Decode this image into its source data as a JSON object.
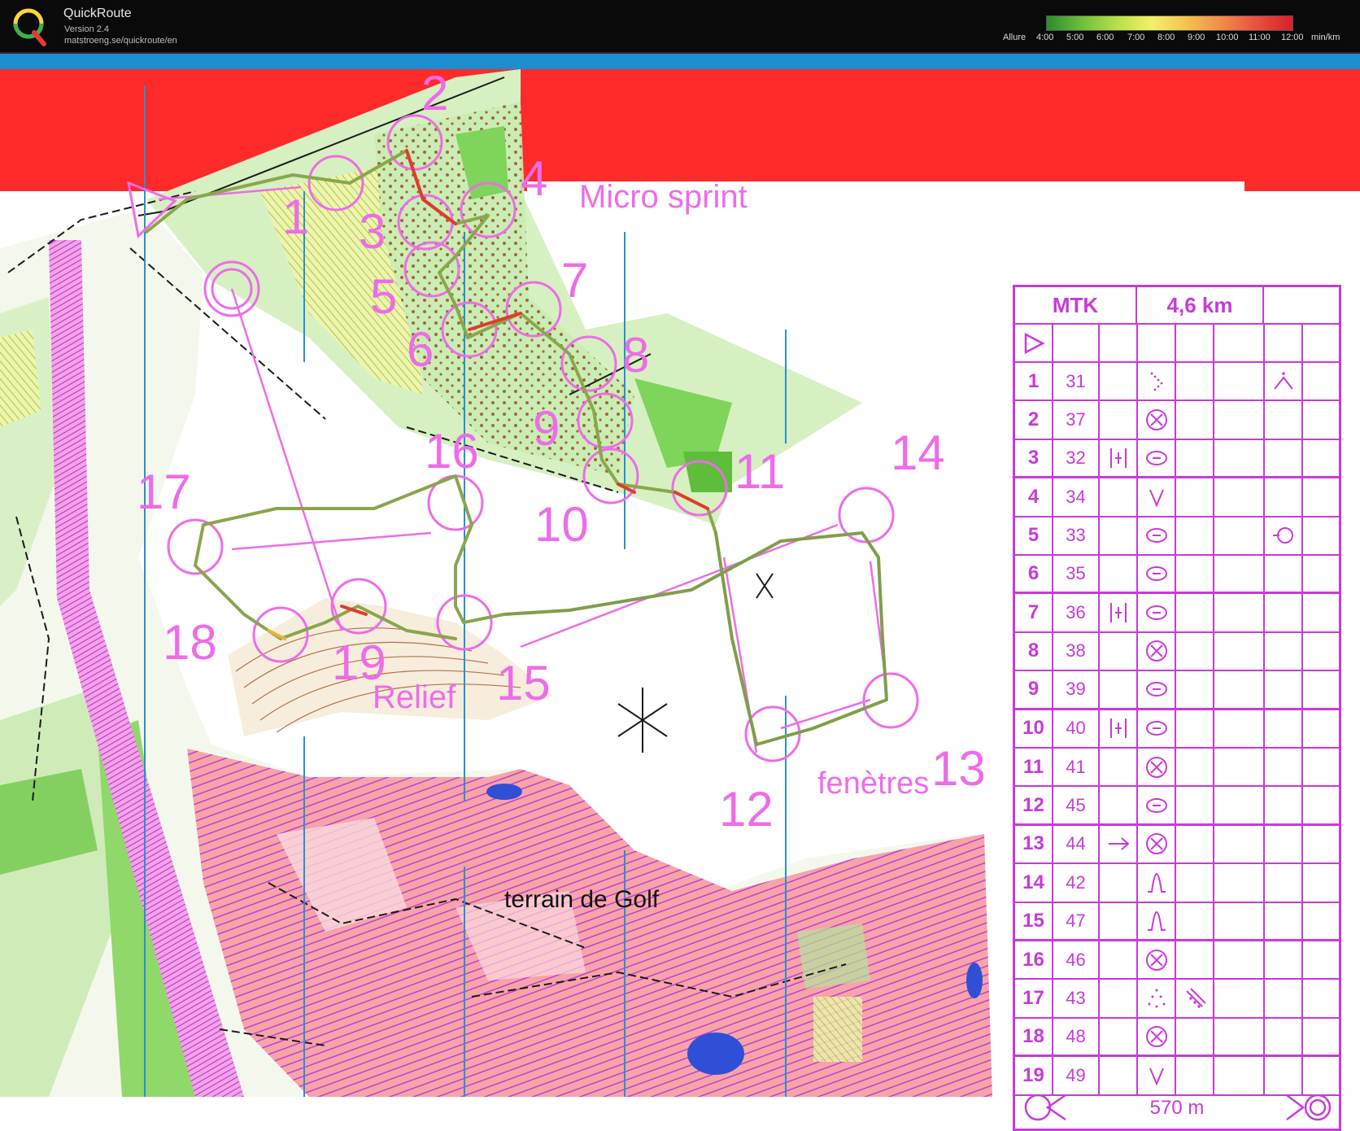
{
  "header": {
    "app_name": "QuickRoute",
    "version": "Version 2.4",
    "url": "matstroeng.se/quickroute/en",
    "pace_caption": "Allure",
    "pace_ticks": [
      "4:00",
      "5:00",
      "6:00",
      "7:00",
      "8:00",
      "9:00",
      "10:00",
      "11:00",
      "12:00"
    ],
    "pace_unit": "min/km"
  },
  "map": {
    "labels": {
      "micro_sprint": "Micro sprint",
      "relief": "Relief",
      "fenetres": "fenètres",
      "golf": "terrain de Golf"
    },
    "controls": [
      "1",
      "2",
      "3",
      "4",
      "5",
      "6",
      "7",
      "8",
      "9",
      "10",
      "11",
      "12",
      "13",
      "14",
      "15",
      "16",
      "17",
      "18",
      "19"
    ]
  },
  "sheet": {
    "club": "MTK",
    "distance": "4,6 km",
    "finish_distance": "570 m",
    "rows": [
      {
        "num": "1",
        "code": "31",
        "feature": "dotted-corner",
        "dim": "",
        "extra": "bend"
      },
      {
        "num": "2",
        "code": "37",
        "feature": "circle-x",
        "dim": "",
        "extra": ""
      },
      {
        "num": "3",
        "code": "32",
        "feature": "ellipse-dash",
        "dim": "",
        "extra": "",
        "pre": "bar-cluster"
      },
      {
        "num": "4",
        "code": "34",
        "feature": "v-shape",
        "dim": "",
        "extra": ""
      },
      {
        "num": "5",
        "code": "33",
        "feature": "ellipse-dash",
        "dim": "",
        "extra": "circle-dash"
      },
      {
        "num": "6",
        "code": "35",
        "feature": "ellipse-dash",
        "dim": "",
        "extra": ""
      },
      {
        "num": "7",
        "code": "36",
        "feature": "ellipse-dash",
        "dim": "",
        "extra": "",
        "pre": "bar-cluster"
      },
      {
        "num": "8",
        "code": "38",
        "feature": "circle-x",
        "dim": "",
        "extra": ""
      },
      {
        "num": "9",
        "code": "39",
        "feature": "ellipse-dash",
        "dim": "",
        "extra": ""
      },
      {
        "num": "10",
        "code": "40",
        "feature": "ellipse-dash",
        "dim": "",
        "extra": "",
        "pre": "bar-cluster"
      },
      {
        "num": "11",
        "code": "41",
        "feature": "circle-x",
        "dim": "",
        "extra": ""
      },
      {
        "num": "12",
        "code": "45",
        "feature": "ellipse-dash",
        "dim": "",
        "extra": ""
      },
      {
        "num": "13",
        "code": "44",
        "feature": "circle-x",
        "dim": "",
        "extra": "",
        "pre": "arrow"
      },
      {
        "num": "14",
        "code": "42",
        "feature": "bell",
        "dim": "",
        "extra": ""
      },
      {
        "num": "15",
        "code": "47",
        "feature": "bell",
        "dim": "",
        "extra": ""
      },
      {
        "num": "16",
        "code": "46",
        "feature": "circle-x",
        "dim": "",
        "extra": ""
      },
      {
        "num": "17",
        "code": "43",
        "feature": "dot-triangle",
        "dim": "diag-dots",
        "extra": ""
      },
      {
        "num": "18",
        "code": "48",
        "feature": "circle-x",
        "dim": "",
        "extra": ""
      },
      {
        "num": "19",
        "code": "49",
        "feature": "v-shape",
        "dim": "",
        "extra": ""
      }
    ]
  },
  "colors": {
    "course_magenta": "#ee6ce8",
    "sheet_magenta": "#c83ad8",
    "forest_green": "#7fd45a",
    "golf_pink": "#f47a8c",
    "open_yellow": "#e6e88a",
    "meridian_blue": "#2a8fd0",
    "red_banner": "#ff2a2a"
  }
}
